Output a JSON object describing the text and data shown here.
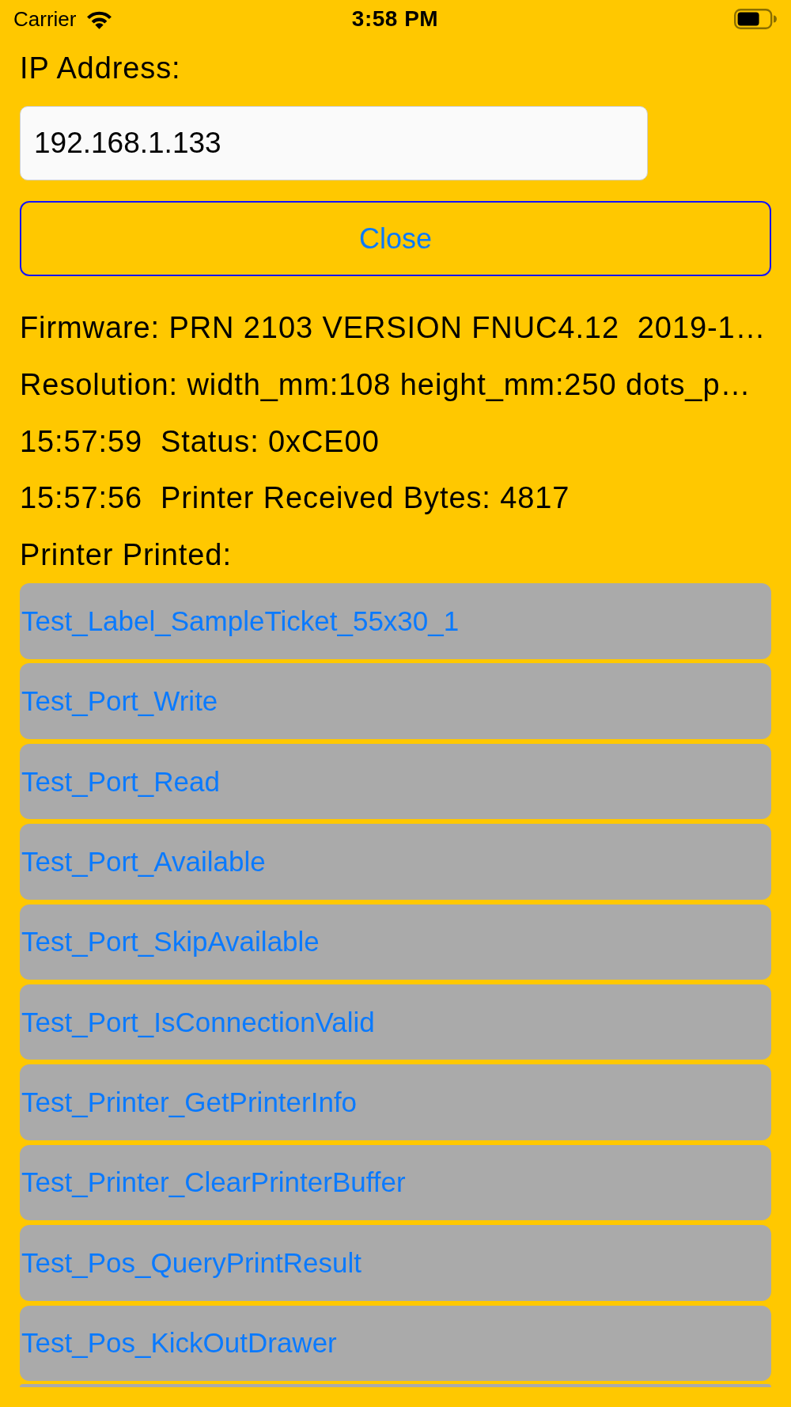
{
  "status_bar": {
    "carrier": "Carrier",
    "time": "3:58 PM"
  },
  "ip_address": {
    "label": "IP Address:",
    "value": "192.168.1.133"
  },
  "close_button": {
    "label": "Close"
  },
  "info": {
    "firmware": "Firmware: PRN 2103 VERSION FNUC4.12  2019-1…",
    "resolution": "Resolution: width_mm:108 height_mm:250 dots_p…",
    "status": "15:57:59  Status: 0xCE00",
    "received_bytes": "15:57:56  Printer Received Bytes: 4817"
  },
  "printed": {
    "label": "Printer Printed:",
    "items": [
      "Test_Label_SampleTicket_55x30_1",
      "Test_Port_Write",
      "Test_Port_Read",
      "Test_Port_Available",
      "Test_Port_SkipAvailable",
      "Test_Port_IsConnectionValid",
      "Test_Printer_GetPrinterInfo",
      "Test_Printer_ClearPrinterBuffer",
      "Test_Pos_QueryPrintResult",
      "Test_Pos_KickOutDrawer"
    ],
    "more_below": true
  }
}
